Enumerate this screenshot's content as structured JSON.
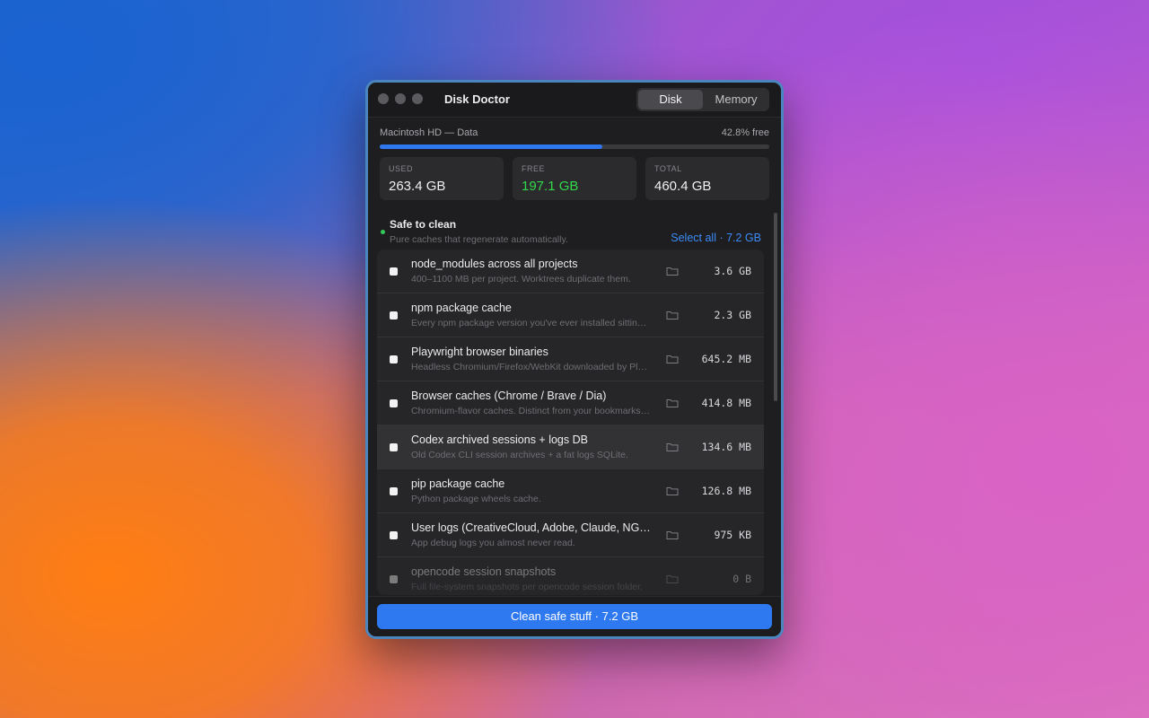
{
  "window": {
    "title": "Disk Doctor",
    "tabs": [
      {
        "label": "Disk",
        "active": true
      },
      {
        "label": "Memory",
        "active": false
      }
    ]
  },
  "volume": {
    "name": "Macintosh HD — Data",
    "free_text": "42.8% free",
    "used_fraction": 0.572
  },
  "stats": [
    {
      "label": "USED",
      "value": "263.4 GB",
      "color": "#f0f0f0"
    },
    {
      "label": "FREE",
      "value": "197.1 GB",
      "color": "#32d74b"
    },
    {
      "label": "TOTAL",
      "value": "460.4 GB",
      "color": "#f0f0f0"
    }
  ],
  "section": {
    "title": "Safe to clean",
    "subtitle": "Pure caches that regenerate automatically.",
    "select_all": "Select all · 7.2 GB",
    "status_color": "#34c759"
  },
  "items": [
    {
      "title": "node_modules across all projects",
      "desc": "400–1100 MB per project. Worktrees duplicate them.",
      "size": "3.6 GB",
      "icon": "folder-icon"
    },
    {
      "title": "npm package cache",
      "desc": "Every npm package version you've ever installed sitting in ~/.npm.",
      "size": "2.3 GB",
      "icon": "folder-icon"
    },
    {
      "title": "Playwright browser binaries",
      "desc": "Headless Chromium/Firefox/WebKit downloaded by Playwright.",
      "size": "645.2 MB",
      "icon": "folder-icon"
    },
    {
      "title": "Browser caches (Chrome / Brave / Dia)",
      "desc": "Chromium-flavor caches. Distinct from your bookmarks and history.",
      "size": "414.8 MB",
      "icon": "folder-icon"
    },
    {
      "title": "Codex archived sessions + logs DB",
      "desc": "Old Codex CLI session archives + a fat logs SQLite.",
      "size": "134.6 MB",
      "icon": "folder-icon"
    },
    {
      "title": "pip package cache",
      "desc": "Python package wheels cache.",
      "size": "126.8 MB",
      "icon": "folder-icon"
    },
    {
      "title": "User logs (CreativeCloud, Adobe, Claude, NGINX)",
      "desc": "App debug logs you almost never read.",
      "size": "975 KB",
      "icon": "folder-icon"
    },
    {
      "title": "opencode session snapshots",
      "desc": "Full file-system snapshots per opencode session folder.",
      "size": "0 B",
      "icon": "folder-icon"
    }
  ],
  "footer": {
    "button_label": "Clean safe stuff · 7.2 GB"
  },
  "colors": {
    "accent": "#2f79f0",
    "link": "#3b8bf7",
    "free": "#32d74b"
  }
}
